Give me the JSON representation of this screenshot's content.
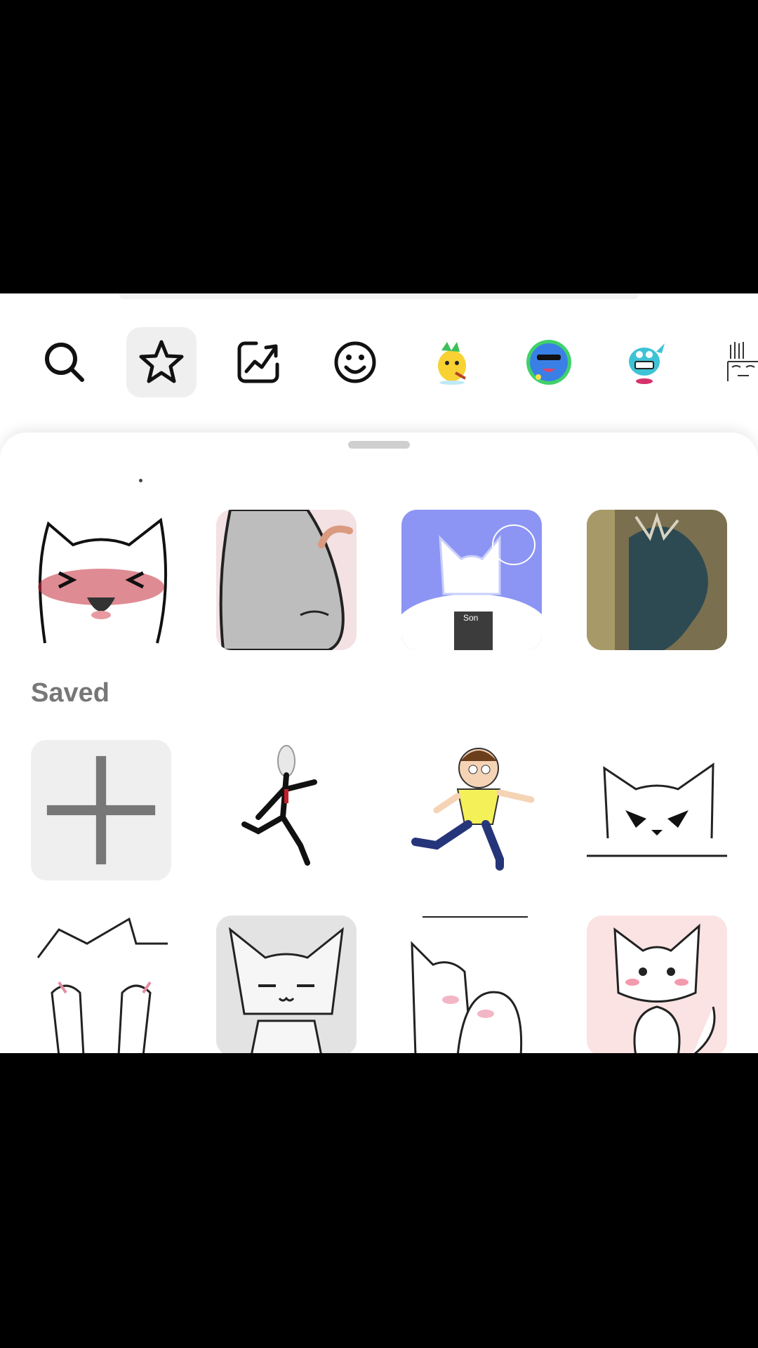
{
  "tabs": [
    {
      "name": "search",
      "icon": "search-icon",
      "active": false
    },
    {
      "name": "favorites",
      "icon": "star-icon",
      "active": true
    },
    {
      "name": "trending",
      "icon": "trending-chart-icon",
      "active": false
    },
    {
      "name": "emoji",
      "icon": "smiley-icon",
      "active": false
    },
    {
      "name": "sticker-pack-1",
      "icon": "yellow-creature-sticker-icon",
      "active": false
    },
    {
      "name": "sticker-pack-2",
      "icon": "blue-blob-sticker-icon",
      "active": false
    },
    {
      "name": "sticker-pack-3",
      "icon": "teal-fish-sticker-icon",
      "active": false
    },
    {
      "name": "sticker-pack-4",
      "icon": "sketch-face-sticker-icon",
      "active": false
    }
  ],
  "recent": {
    "items": [
      {
        "icon": "blushing-cat-sticker"
      },
      {
        "icon": "grey-leggings-sticker"
      },
      {
        "icon": "blue-cat-meme-sticker",
        "caption": "Son"
      },
      {
        "icon": "cat-tail-photo-sticker"
      }
    ]
  },
  "saved": {
    "title": "Saved",
    "add_label": "+",
    "items": [
      {
        "icon": "slenderman-running-sticker"
      },
      {
        "icon": "morty-running-sticker"
      },
      {
        "icon": "angry-cat-face-sticker"
      },
      {
        "icon": "shy-cat-covering-face-sticker"
      },
      {
        "icon": "smiling-grey-cat-sticker"
      },
      {
        "icon": "cats-cuddling-sticker"
      },
      {
        "icon": "blushing-pink-cat-sticker"
      }
    ]
  },
  "colors": {
    "active_tab_bg": "#efefef",
    "section_title": "#777777",
    "tile_placeholder": "#efefef"
  }
}
